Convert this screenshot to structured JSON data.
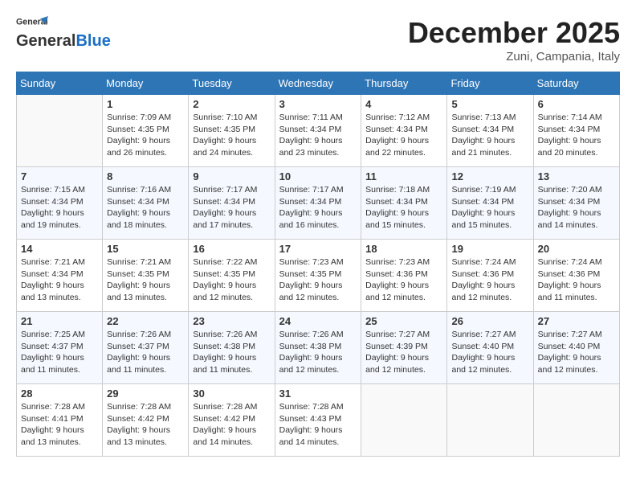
{
  "header": {
    "logo_general": "General",
    "logo_blue": "Blue",
    "month_title": "December 2025",
    "subtitle": "Zuni, Campania, Italy"
  },
  "days_of_week": [
    "Sunday",
    "Monday",
    "Tuesday",
    "Wednesday",
    "Thursday",
    "Friday",
    "Saturday"
  ],
  "weeks": [
    [
      {
        "day": "",
        "content": ""
      },
      {
        "day": "1",
        "content": "Sunrise: 7:09 AM\nSunset: 4:35 PM\nDaylight: 9 hours\nand 26 minutes."
      },
      {
        "day": "2",
        "content": "Sunrise: 7:10 AM\nSunset: 4:35 PM\nDaylight: 9 hours\nand 24 minutes."
      },
      {
        "day": "3",
        "content": "Sunrise: 7:11 AM\nSunset: 4:34 PM\nDaylight: 9 hours\nand 23 minutes."
      },
      {
        "day": "4",
        "content": "Sunrise: 7:12 AM\nSunset: 4:34 PM\nDaylight: 9 hours\nand 22 minutes."
      },
      {
        "day": "5",
        "content": "Sunrise: 7:13 AM\nSunset: 4:34 PM\nDaylight: 9 hours\nand 21 minutes."
      },
      {
        "day": "6",
        "content": "Sunrise: 7:14 AM\nSunset: 4:34 PM\nDaylight: 9 hours\nand 20 minutes."
      }
    ],
    [
      {
        "day": "7",
        "content": "Sunrise: 7:15 AM\nSunset: 4:34 PM\nDaylight: 9 hours\nand 19 minutes."
      },
      {
        "day": "8",
        "content": "Sunrise: 7:16 AM\nSunset: 4:34 PM\nDaylight: 9 hours\nand 18 minutes."
      },
      {
        "day": "9",
        "content": "Sunrise: 7:17 AM\nSunset: 4:34 PM\nDaylight: 9 hours\nand 17 minutes."
      },
      {
        "day": "10",
        "content": "Sunrise: 7:17 AM\nSunset: 4:34 PM\nDaylight: 9 hours\nand 16 minutes."
      },
      {
        "day": "11",
        "content": "Sunrise: 7:18 AM\nSunset: 4:34 PM\nDaylight: 9 hours\nand 15 minutes."
      },
      {
        "day": "12",
        "content": "Sunrise: 7:19 AM\nSunset: 4:34 PM\nDaylight: 9 hours\nand 15 minutes."
      },
      {
        "day": "13",
        "content": "Sunrise: 7:20 AM\nSunset: 4:34 PM\nDaylight: 9 hours\nand 14 minutes."
      }
    ],
    [
      {
        "day": "14",
        "content": "Sunrise: 7:21 AM\nSunset: 4:34 PM\nDaylight: 9 hours\nand 13 minutes."
      },
      {
        "day": "15",
        "content": "Sunrise: 7:21 AM\nSunset: 4:35 PM\nDaylight: 9 hours\nand 13 minutes."
      },
      {
        "day": "16",
        "content": "Sunrise: 7:22 AM\nSunset: 4:35 PM\nDaylight: 9 hours\nand 12 minutes."
      },
      {
        "day": "17",
        "content": "Sunrise: 7:23 AM\nSunset: 4:35 PM\nDaylight: 9 hours\nand 12 minutes."
      },
      {
        "day": "18",
        "content": "Sunrise: 7:23 AM\nSunset: 4:36 PM\nDaylight: 9 hours\nand 12 minutes."
      },
      {
        "day": "19",
        "content": "Sunrise: 7:24 AM\nSunset: 4:36 PM\nDaylight: 9 hours\nand 12 minutes."
      },
      {
        "day": "20",
        "content": "Sunrise: 7:24 AM\nSunset: 4:36 PM\nDaylight: 9 hours\nand 11 minutes."
      }
    ],
    [
      {
        "day": "21",
        "content": "Sunrise: 7:25 AM\nSunset: 4:37 PM\nDaylight: 9 hours\nand 11 minutes."
      },
      {
        "day": "22",
        "content": "Sunrise: 7:26 AM\nSunset: 4:37 PM\nDaylight: 9 hours\nand 11 minutes."
      },
      {
        "day": "23",
        "content": "Sunrise: 7:26 AM\nSunset: 4:38 PM\nDaylight: 9 hours\nand 11 minutes."
      },
      {
        "day": "24",
        "content": "Sunrise: 7:26 AM\nSunset: 4:38 PM\nDaylight: 9 hours\nand 12 minutes."
      },
      {
        "day": "25",
        "content": "Sunrise: 7:27 AM\nSunset: 4:39 PM\nDaylight: 9 hours\nand 12 minutes."
      },
      {
        "day": "26",
        "content": "Sunrise: 7:27 AM\nSunset: 4:40 PM\nDaylight: 9 hours\nand 12 minutes."
      },
      {
        "day": "27",
        "content": "Sunrise: 7:27 AM\nSunset: 4:40 PM\nDaylight: 9 hours\nand 12 minutes."
      }
    ],
    [
      {
        "day": "28",
        "content": "Sunrise: 7:28 AM\nSunset: 4:41 PM\nDaylight: 9 hours\nand 13 minutes."
      },
      {
        "day": "29",
        "content": "Sunrise: 7:28 AM\nSunset: 4:42 PM\nDaylight: 9 hours\nand 13 minutes."
      },
      {
        "day": "30",
        "content": "Sunrise: 7:28 AM\nSunset: 4:42 PM\nDaylight: 9 hours\nand 14 minutes."
      },
      {
        "day": "31",
        "content": "Sunrise: 7:28 AM\nSunset: 4:43 PM\nDaylight: 9 hours\nand 14 minutes."
      },
      {
        "day": "",
        "content": ""
      },
      {
        "day": "",
        "content": ""
      },
      {
        "day": "",
        "content": ""
      }
    ]
  ]
}
